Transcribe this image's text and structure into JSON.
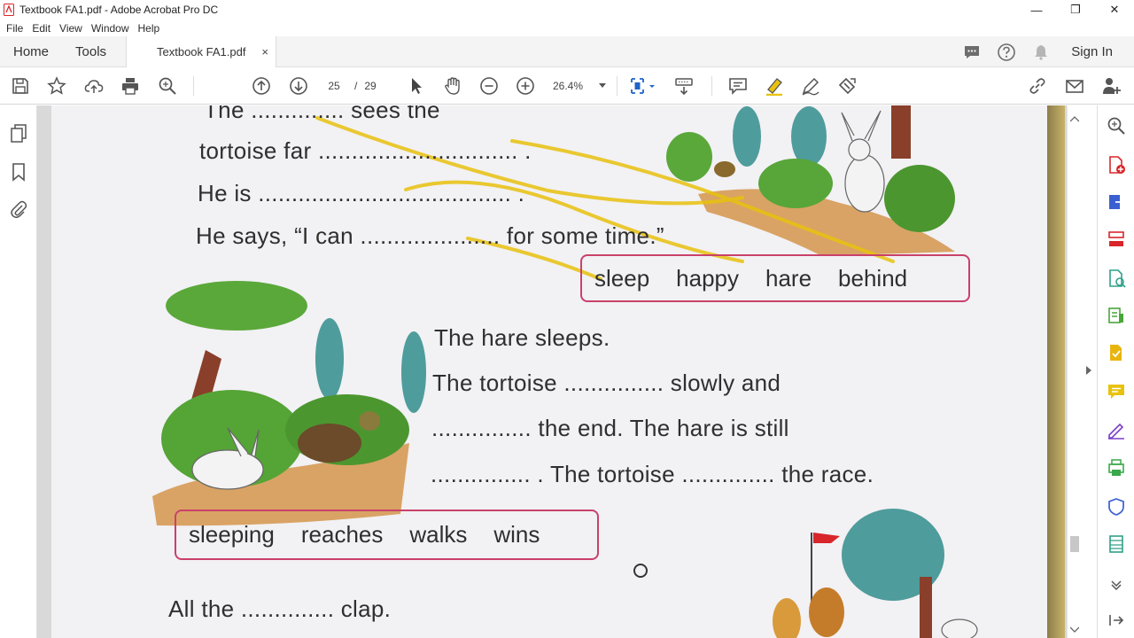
{
  "window": {
    "title": "Textbook FA1.pdf - Adobe Acrobat Pro DC",
    "controls": [
      "—",
      "❐",
      "✕"
    ]
  },
  "menu": [
    "File",
    "Edit",
    "View",
    "Window",
    "Help"
  ],
  "tabs": {
    "home": "Home",
    "tools": "Tools",
    "document": "Textbook FA1.pdf",
    "close": "×",
    "sign_in": "Sign In"
  },
  "toolbar": {
    "page_current": "25",
    "page_sep": "/",
    "page_total": "29",
    "zoom": "26.4%"
  },
  "page": {
    "lines_top": [
      "The .............. sees the",
      "tortoise far .............................. .",
      "He is ...................................... .",
      "He says, “I can ..................... for some time.”"
    ],
    "words_box_1": [
      "sleep",
      "happy",
      "hare",
      "behind"
    ],
    "lines_middle": [
      "The hare sleeps.",
      "The tortoise ............... slowly and",
      "............... the end.  The hare is still",
      "............... . The tortoise .............. the race."
    ],
    "words_box_2": [
      "sleeping",
      "reaches",
      "walks",
      "wins"
    ],
    "line_bottom": "All the .............. clap."
  },
  "colors": {
    "highlight": "#e8c20f",
    "word_box_border": "#c9416a",
    "accent_red": "#d8262b",
    "tool_blue": "#1f63c9"
  }
}
